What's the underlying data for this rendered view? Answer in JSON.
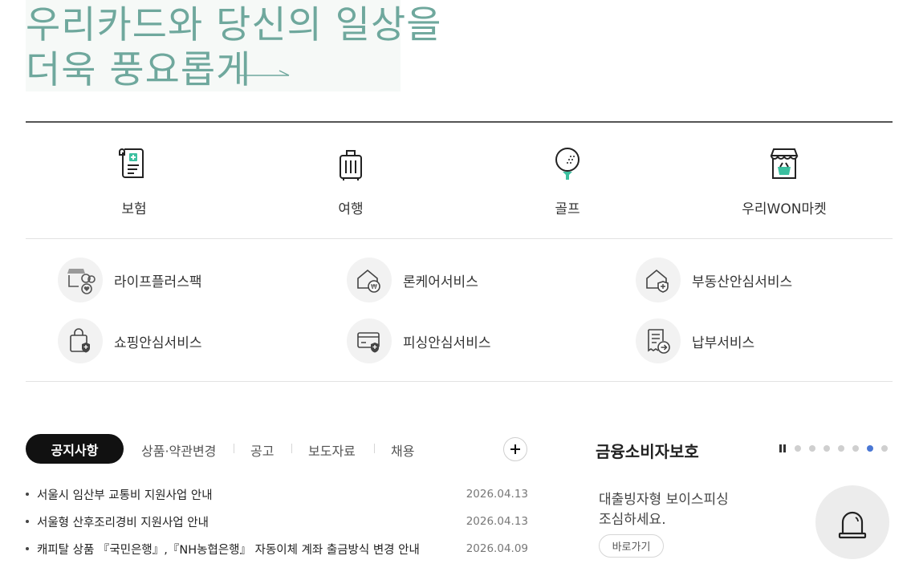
{
  "hero": {
    "line1": "우리카드와 당신의 일상을",
    "line2": "더욱 풍요롭게"
  },
  "quick_menu": [
    {
      "label": "보험",
      "icon": "insurance-document-icon"
    },
    {
      "label": "여행",
      "icon": "luggage-icon"
    },
    {
      "label": "골프",
      "icon": "golf-ball-icon"
    },
    {
      "label": "우리WON마켓",
      "icon": "market-store-icon"
    }
  ],
  "services": [
    {
      "label": "라이프플러스팩",
      "icon": "life-plus-store-icon"
    },
    {
      "label": "론케어서비스",
      "icon": "loan-care-home-icon"
    },
    {
      "label": "부동산안심서비스",
      "icon": "real-estate-safe-icon"
    },
    {
      "label": "쇼핑안심서비스",
      "icon": "shopping-bag-shield-icon"
    },
    {
      "label": "피싱안심서비스",
      "icon": "card-shield-icon"
    },
    {
      "label": "납부서비스",
      "icon": "bill-payment-icon"
    }
  ],
  "notice": {
    "tabs": [
      "공지사항",
      "상품·약관변경",
      "공고",
      "보도자료",
      "채용"
    ],
    "items": [
      {
        "title": "서울시 임산부 교통비 지원사업 안내",
        "date": "2026.04.13"
      },
      {
        "title": "서울형 산후조리경비 지원사업 안내",
        "date": "2026.04.13"
      },
      {
        "title": "캐피탈 상품 『국민은행』,『NH농협은행』 자동이체 계좌 출금방식 변경 안내",
        "date": "2026.04.09"
      }
    ]
  },
  "protection": {
    "title": "금융소비자보호",
    "text_line1": "대출빙자형 보이스피싱",
    "text_line2": "조심하세요.",
    "button": "바로가기",
    "pager": {
      "total": 7,
      "active": 6
    }
  },
  "colors": {
    "hero_text": "#6fa89d",
    "accent_mint": "#3cc0a0",
    "pager_active": "#4a77d4"
  }
}
